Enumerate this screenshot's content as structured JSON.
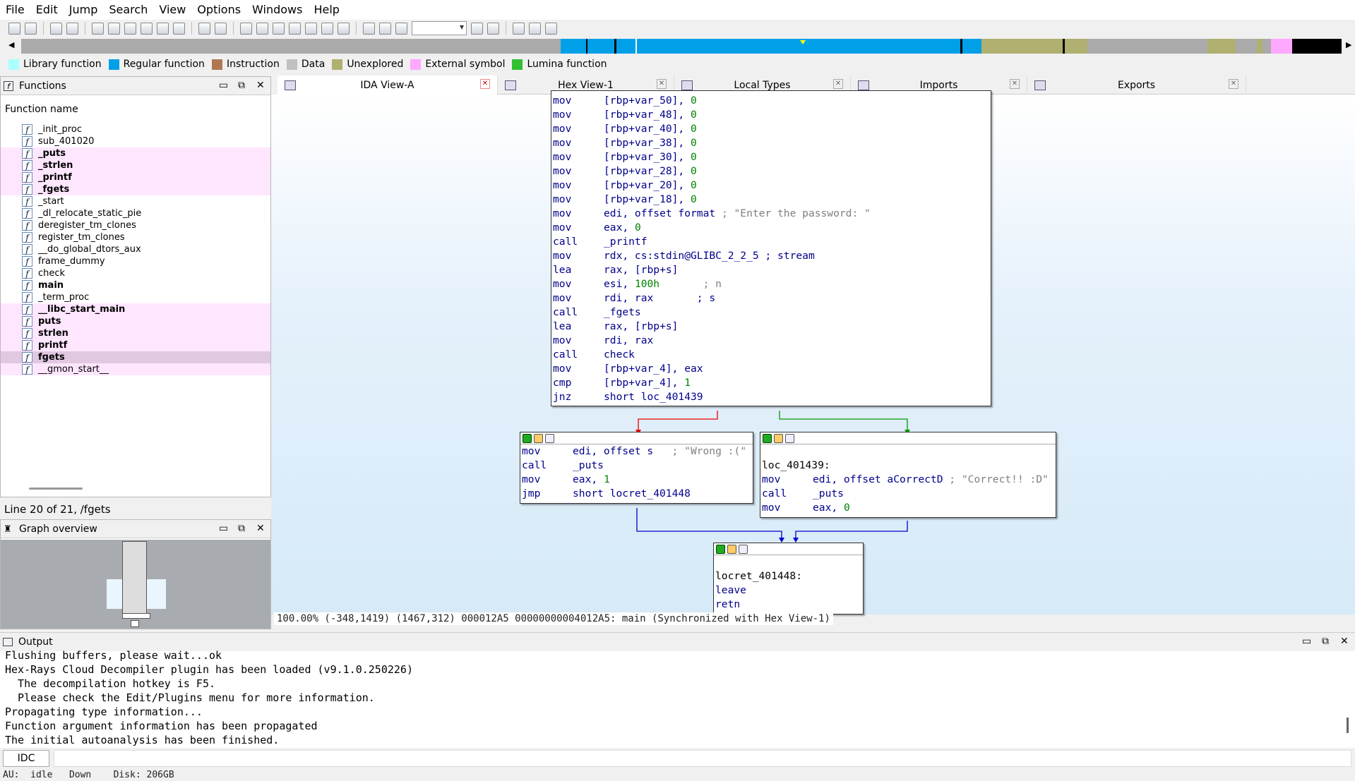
{
  "menu": [
    "File",
    "Edit",
    "Jump",
    "Search",
    "View",
    "Options",
    "Windows",
    "Help"
  ],
  "legend": [
    {
      "label": "Library function",
      "color": "#aaffff"
    },
    {
      "label": "Regular function",
      "color": "#00a0e8"
    },
    {
      "label": "Instruction",
      "color": "#b07850"
    },
    {
      "label": "Data",
      "color": "#c0c0c0"
    },
    {
      "label": "Unexplored",
      "color": "#b0b070"
    },
    {
      "label": "External symbol",
      "color": "#ffa8ff"
    },
    {
      "label": "Lumina function",
      "color": "#30c030"
    }
  ],
  "functions_panel": {
    "title": "Functions",
    "column_header": "Function name",
    "items": [
      {
        "name": "_init_proc",
        "lib": false,
        "bold": false
      },
      {
        "name": "sub_401020",
        "lib": false,
        "bold": false
      },
      {
        "name": "_puts",
        "lib": true,
        "bold": true
      },
      {
        "name": "_strlen",
        "lib": true,
        "bold": true
      },
      {
        "name": "_printf",
        "lib": true,
        "bold": true
      },
      {
        "name": "_fgets",
        "lib": true,
        "bold": true
      },
      {
        "name": "_start",
        "lib": false,
        "bold": false
      },
      {
        "name": "_dl_relocate_static_pie",
        "lib": false,
        "bold": false
      },
      {
        "name": "deregister_tm_clones",
        "lib": false,
        "bold": false
      },
      {
        "name": "register_tm_clones",
        "lib": false,
        "bold": false
      },
      {
        "name": "__do_global_dtors_aux",
        "lib": false,
        "bold": false
      },
      {
        "name": "frame_dummy",
        "lib": false,
        "bold": false
      },
      {
        "name": "check",
        "lib": false,
        "bold": false
      },
      {
        "name": "main",
        "lib": false,
        "bold": true
      },
      {
        "name": "_term_proc",
        "lib": false,
        "bold": false
      },
      {
        "name": "__libc_start_main",
        "lib": true,
        "bold": true
      },
      {
        "name": "puts",
        "lib": true,
        "bold": true
      },
      {
        "name": "strlen",
        "lib": true,
        "bold": true
      },
      {
        "name": "printf",
        "lib": true,
        "bold": true
      },
      {
        "name": "fgets",
        "lib": true,
        "bold": true,
        "selected": true
      },
      {
        "name": "__gmon_start__",
        "lib": true,
        "bold": false
      }
    ],
    "status": "Line 20 of 21, /fgets"
  },
  "graph_overview": {
    "title": "Graph overview"
  },
  "tabs": [
    {
      "label": "IDA View-A",
      "active": true
    },
    {
      "label": "Hex View-1",
      "active": false
    },
    {
      "label": "Local Types",
      "active": false
    },
    {
      "label": "Imports",
      "active": false
    },
    {
      "label": "Exports",
      "active": false
    }
  ],
  "main_block": [
    {
      "m": "mov",
      "o": "[rbp+var_50], ",
      "n": "0",
      "c": ""
    },
    {
      "m": "mov",
      "o": "[rbp+var_48], ",
      "n": "0",
      "c": ""
    },
    {
      "m": "mov",
      "o": "[rbp+var_40], ",
      "n": "0",
      "c": ""
    },
    {
      "m": "mov",
      "o": "[rbp+var_38], ",
      "n": "0",
      "c": ""
    },
    {
      "m": "mov",
      "o": "[rbp+var_30], ",
      "n": "0",
      "c": ""
    },
    {
      "m": "mov",
      "o": "[rbp+var_28], ",
      "n": "0",
      "c": ""
    },
    {
      "m": "mov",
      "o": "[rbp+var_20], ",
      "n": "0",
      "c": ""
    },
    {
      "m": "mov",
      "o": "[rbp+var_18], ",
      "n": "0",
      "c": ""
    },
    {
      "m": "mov",
      "o": "edi, offset format ",
      "n": "",
      "c": "; \"Enter the password: \""
    },
    {
      "m": "mov",
      "o": "eax, ",
      "n": "0",
      "c": ""
    },
    {
      "m": "call",
      "o": "_printf",
      "n": "",
      "c": ""
    },
    {
      "m": "mov",
      "o": "rdx, cs:stdin@GLIBC_2_2_5 ; stream",
      "n": "",
      "c": ""
    },
    {
      "m": "lea",
      "o": "rax, [rbp+s]",
      "n": "",
      "c": ""
    },
    {
      "m": "mov",
      "o": "esi, ",
      "n": "100h",
      "c": "       ; n"
    },
    {
      "m": "mov",
      "o": "rdi, rax       ; s",
      "n": "",
      "c": ""
    },
    {
      "m": "call",
      "o": "_fgets",
      "n": "",
      "c": ""
    },
    {
      "m": "lea",
      "o": "rax, [rbp+s]",
      "n": "",
      "c": ""
    },
    {
      "m": "mov",
      "o": "rdi, rax",
      "n": "",
      "c": ""
    },
    {
      "m": "call",
      "o": "check",
      "n": "",
      "c": ""
    },
    {
      "m": "mov",
      "o": "[rbp+var_4], eax",
      "n": "",
      "c": ""
    },
    {
      "m": "cmp",
      "o": "[rbp+var_4], ",
      "n": "1",
      "c": ""
    },
    {
      "m": "jnz",
      "o": "short loc_401439",
      "n": "",
      "c": ""
    }
  ],
  "wrong_block": [
    {
      "m": "mov",
      "o": "edi, offset s   ",
      "n": "",
      "c": "; \"Wrong :(\""
    },
    {
      "m": "call",
      "o": "_puts",
      "n": "",
      "c": ""
    },
    {
      "m": "mov",
      "o": "eax, ",
      "n": "1",
      "c": ""
    },
    {
      "m": "jmp",
      "o": "short locret_401448",
      "n": "",
      "c": ""
    }
  ],
  "correct_block": {
    "label": "loc_401439:",
    "lines": [
      {
        "m": "mov",
        "o": "edi, offset aCorrectD ",
        "n": "",
        "c": "; \"Correct!! :D\""
      },
      {
        "m": "call",
        "o": "_puts",
        "n": "",
        "c": ""
      },
      {
        "m": "mov",
        "o": "eax, ",
        "n": "0",
        "c": ""
      }
    ]
  },
  "ret_block": {
    "label": "locret_401448:",
    "lines": [
      {
        "m": "leave",
        "o": "",
        "n": "",
        "c": ""
      },
      {
        "m": "retn",
        "o": "",
        "n": "",
        "c": ""
      }
    ]
  },
  "graph_status": "100.00% (-348,1419) (1467,312) 000012A5 00000000004012A5: main (Synchronized with Hex View-1)",
  "output": {
    "title": "Output",
    "lines": [
      "Flushing buffers, please wait...ok",
      "Hex-Rays Cloud Decompiler plugin has been loaded (v9.1.0.250226)",
      "  The decompilation hotkey is F5.",
      "  Please check the Edit/Plugins menu for more information.",
      "Propagating type information...",
      "Function argument information has been propagated",
      "The initial autoanalysis has been finished."
    ]
  },
  "idc_label": "IDC",
  "statusbar": {
    "au": "AU:",
    "state": "idle",
    "dir": "Down",
    "disk": "Disk: 206GB"
  }
}
